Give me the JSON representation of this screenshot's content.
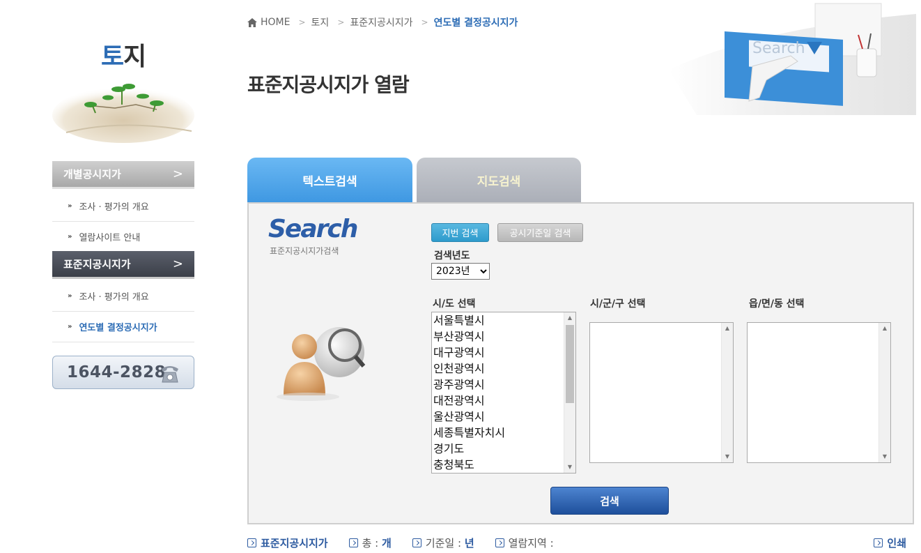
{
  "sidebar": {
    "logo_part1": "토",
    "logo_part2": "지",
    "menu": [
      {
        "label": "개별공시지가",
        "chevron": ">"
      },
      {
        "label": "표준지공시지가",
        "chevron": ">"
      }
    ],
    "sub_items_group1": [
      "조사 · 평가의 개요",
      "열람사이트 안내"
    ],
    "sub_items_group2": [
      "조사 · 평가의 개요",
      "연도별 결정공시지가"
    ],
    "phone": "1644-2828",
    "sub_arrow": "»"
  },
  "breadcrumb": {
    "home": "HOME",
    "items": [
      "토지",
      "표준지공시지가",
      "연도별 결정공시지가"
    ],
    "separator": ">"
  },
  "page_title": "표준지공시지가 열람",
  "header_art_text": "Search",
  "tabs": [
    {
      "label": "텍스트검색",
      "active": true
    },
    {
      "label": "지도검색",
      "active": false
    }
  ],
  "panel": {
    "logo": "Search",
    "logo_sub": "표준지공시지가검색",
    "buttons": {
      "jibun": "지번 검색",
      "gosi": "공시기준일 검색"
    },
    "year_label": "검색년도",
    "year_value": "2023년",
    "sido_label": "시/도 선택",
    "sigungu_label": "시/군/구 선택",
    "eupmyeondong_label": "읍/면/동 선택",
    "sido_options": [
      "서울특별시",
      "부산광역시",
      "대구광역시",
      "인천광역시",
      "광주광역시",
      "대전광역시",
      "울산광역시",
      "세종특별자치시",
      "경기도",
      "충청북도"
    ],
    "search_button": "검색"
  },
  "info_bar": {
    "category": "표준지공시지가",
    "total_label": "총 :",
    "total_unit": "개",
    "base_date_label": "기준일 :",
    "base_date_unit": "년",
    "region_label": "열람지역 :",
    "print_label": "인쇄"
  },
  "colors": {
    "brand_blue": "#2c6cb5",
    "tab_active": "#4fa6ea",
    "search_button": "#2a62b4"
  }
}
